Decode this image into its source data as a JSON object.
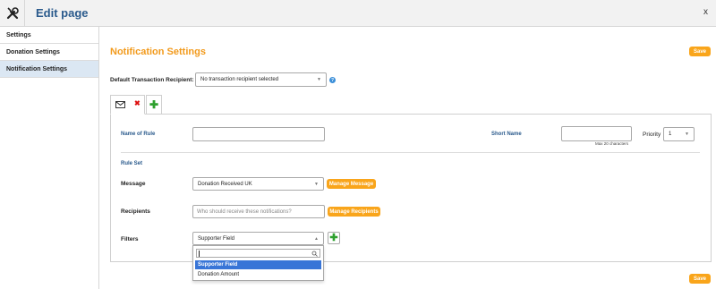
{
  "header": {
    "title": "Edit page",
    "close_label": "x",
    "tool_icon": "tools-icon"
  },
  "sidebar": {
    "items": [
      {
        "label": "Settings",
        "active": false
      },
      {
        "label": "Donation Settings",
        "active": false
      },
      {
        "label": "Notification Settings",
        "active": true
      }
    ]
  },
  "main": {
    "title": "Notification Settings",
    "save_label": "Save",
    "default_recipient": {
      "label": "Default Transaction Recipient:",
      "value": "No transaction recipient selected",
      "help_icon": "?"
    },
    "tabs": {
      "mail_icon": "envelope-icon",
      "remove_icon": "✖",
      "add_icon": "✚"
    },
    "rule": {
      "name_label": "Name of Rule",
      "name_value": "",
      "short_name_label": "Short Name",
      "short_name_value": "",
      "short_name_hint": "Max 20 characters",
      "priority_label": "Priority",
      "priority_value": "1",
      "ruleset_label": "Rule Set",
      "message_label": "Message",
      "message_value": "Donation Received UK",
      "manage_message_label": "Manage Message",
      "recipients_label": "Recipients",
      "recipients_placeholder": "Who should receive these notifications?",
      "manage_recipients_label": "Manage Recipients",
      "filters_label": "Filters",
      "filters_value": "Supporter Field",
      "filter_options": [
        "Supporter Field",
        "Donation Amount"
      ],
      "highlighted_option": "Supporter Field"
    }
  },
  "colors": {
    "accent": "#f9a51b",
    "title": "#f29a1c",
    "link_blue": "#2a5a8c",
    "active_bg": "#dbe7f3",
    "highlight": "#3875d7"
  }
}
